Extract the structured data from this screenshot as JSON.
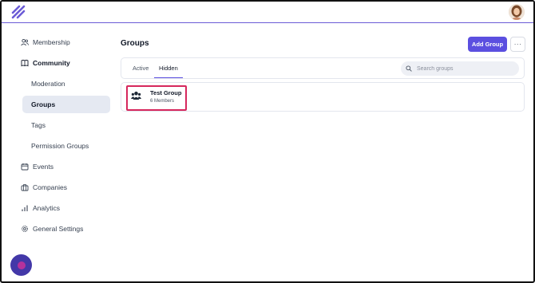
{
  "sidebar": {
    "items": [
      {
        "label": "Membership",
        "icon": "users-icon"
      },
      {
        "label": "Community",
        "icon": "book-icon"
      },
      {
        "label": "Moderation"
      },
      {
        "label": "Groups"
      },
      {
        "label": "Tags"
      },
      {
        "label": "Permission Groups"
      },
      {
        "label": "Events",
        "icon": "calendar-icon"
      },
      {
        "label": "Companies",
        "icon": "briefcase-icon"
      },
      {
        "label": "Analytics",
        "icon": "bar-chart-icon"
      },
      {
        "label": "General Settings",
        "icon": "gear-icon"
      }
    ],
    "active": "Groups"
  },
  "main": {
    "title": "Groups",
    "add_button": "Add Group",
    "more_button": "···",
    "tabs": [
      {
        "label": "Active"
      },
      {
        "label": "Hidden",
        "selected": true
      }
    ],
    "search": {
      "placeholder": "Search groups",
      "value": ""
    },
    "groups": [
      {
        "name": "Test Group",
        "members": "6 Members"
      }
    ]
  },
  "colors": {
    "accent": "#5b4fe0",
    "highlight": "#d6275d",
    "active_nav_bg": "#e5e9f2",
    "fab": "#4338a8"
  }
}
